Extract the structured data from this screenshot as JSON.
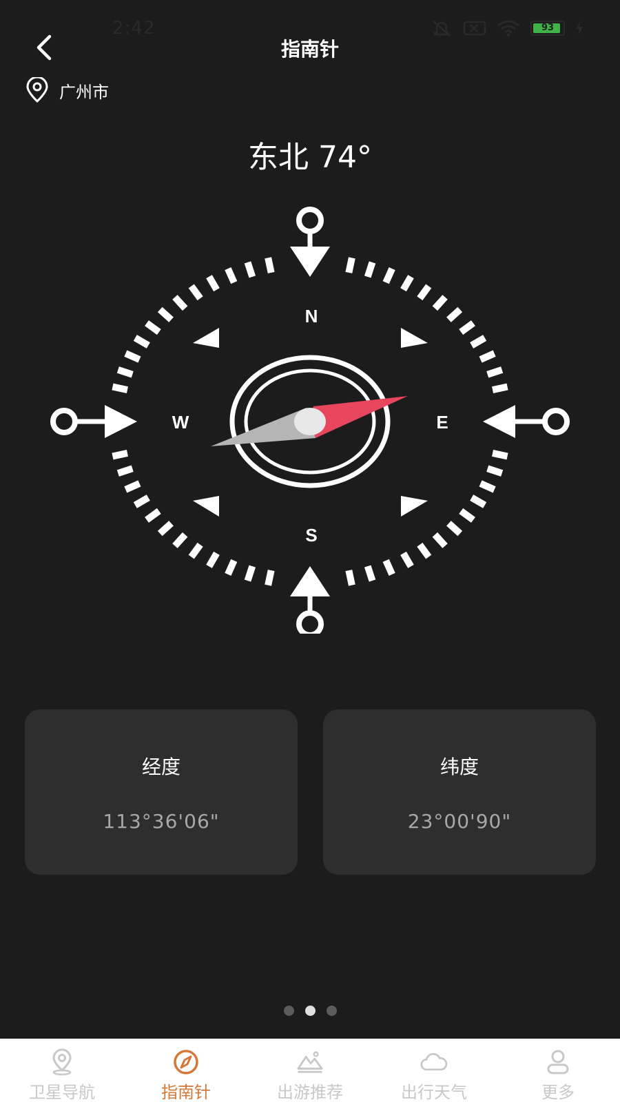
{
  "status_bar": {
    "time": "2:42",
    "battery": "93"
  },
  "header": {
    "title": "指南针",
    "back_icon": "chevron-left-icon"
  },
  "location": {
    "icon": "location-pin-icon",
    "city": "广州市"
  },
  "heading": {
    "text": "东北 74°",
    "degrees": 74
  },
  "compass": {
    "labels": {
      "north": "N",
      "south": "S",
      "east": "E",
      "west": "W"
    },
    "needle_colors": {
      "north": "#e8465d",
      "south": "#b5b5b5"
    }
  },
  "cards": [
    {
      "title": "经度",
      "value": "113°36'06\""
    },
    {
      "title": "纬度",
      "value": "23°00'90\""
    }
  ],
  "pager": {
    "count": 3,
    "active_index": 1
  },
  "bottom_nav": {
    "active_color": "#d4783a",
    "items": [
      {
        "label": "卫星导航",
        "icon": "map-pin-icon"
      },
      {
        "label": "指南针",
        "icon": "compass-icon",
        "active": true
      },
      {
        "label": "出游推荐",
        "icon": "mountain-icon"
      },
      {
        "label": "出行天气",
        "icon": "cloud-icon"
      },
      {
        "label": "更多",
        "icon": "user-icon"
      }
    ]
  }
}
